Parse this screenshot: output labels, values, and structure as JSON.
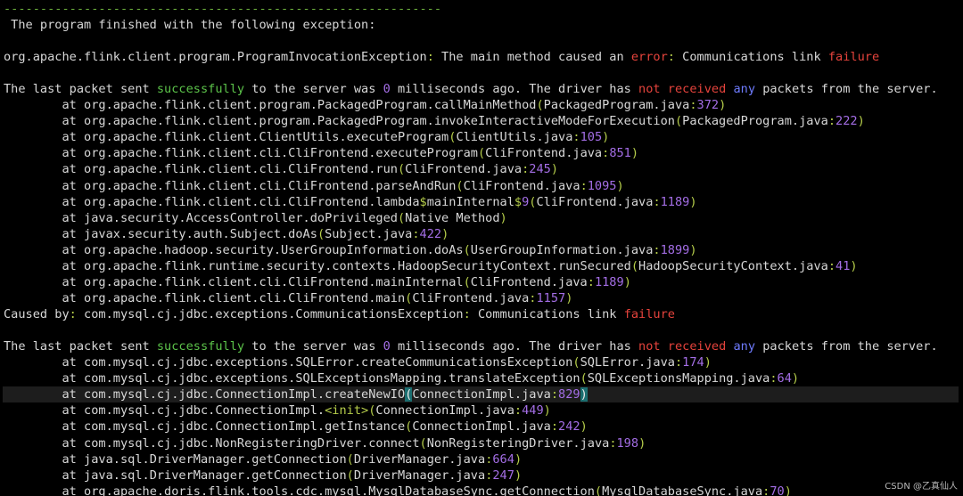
{
  "colors": {
    "background": "#000000",
    "text": "#d8d8d8",
    "separator": "#68a93b",
    "punctuation": "#b5cd4a",
    "number": "#a46ee6",
    "keyword_red": "#e5433c",
    "keyword_green": "#5cc34a",
    "keyword_blue": "#6f7cff",
    "cursor_highlight": "#1b6e70"
  },
  "terminal": {
    "separator": "------------------------------------------------------------",
    "header": " The program finished with the following exception:",
    "exception_line": {
      "class": "org.apache.flink.client.program.ProgramInvocationException",
      "colon": ":",
      "message1": " The main method caused an ",
      "word_error": "error",
      "colon2": ":",
      "message2": " Communications link ",
      "word_failure": "failure"
    },
    "packet_line": {
      "p1": "The last packet sent ",
      "w_successfully": "successfully",
      "p2": " to the server was ",
      "n_ms": "0",
      "p3": " milliseconds ago. The driver has ",
      "w_not": "not",
      "sp1": " ",
      "w_received": "received",
      "sp2": " ",
      "w_any": "any",
      "p4": " packets from the server."
    },
    "stack1": [
      {
        "prefix": "        at ",
        "method": "org.apache.flink.client.program.PackagedProgram.callMainMethod",
        "open": "(",
        "file": "PackagedProgram.java",
        "colon": ":",
        "line": "372",
        "close": ")"
      },
      {
        "prefix": "        at ",
        "method": "org.apache.flink.client.program.PackagedProgram.invokeInteractiveModeForExecution",
        "open": "(",
        "file": "PackagedProgram.java",
        "colon": ":",
        "line": "222",
        "close": ")"
      },
      {
        "prefix": "        at ",
        "method": "org.apache.flink.client.ClientUtils.executeProgram",
        "open": "(",
        "file": "ClientUtils.java",
        "colon": ":",
        "line": "105",
        "close": ")"
      },
      {
        "prefix": "        at ",
        "method": "org.apache.flink.client.cli.CliFrontend.executeProgram",
        "open": "(",
        "file": "CliFrontend.java",
        "colon": ":",
        "line": "851",
        "close": ")"
      },
      {
        "prefix": "        at ",
        "method": "org.apache.flink.client.cli.CliFrontend.run",
        "open": "(",
        "file": "CliFrontend.java",
        "colon": ":",
        "line": "245",
        "close": ")"
      },
      {
        "prefix": "        at ",
        "method": "org.apache.flink.client.cli.CliFrontend.parseAndRun",
        "open": "(",
        "file": "CliFrontend.java",
        "colon": ":",
        "line": "1095",
        "close": ")"
      },
      {
        "prefix": "        at ",
        "method": "org.apache.flink.client.cli.CliFrontend.lambda",
        "dollar": "$",
        "method2": "mainInternal",
        "dollar2": "$",
        "lambda_num": "9",
        "open": "(",
        "file": "CliFrontend.java",
        "colon": ":",
        "line": "1189",
        "close": ")"
      },
      {
        "prefix": "        at ",
        "method": "java.security.AccessController.doPrivileged",
        "open": "(",
        "file": "Native Method",
        "colon": "",
        "line": "",
        "close": ")"
      },
      {
        "prefix": "        at ",
        "method": "javax.security.auth.Subject.doAs",
        "open": "(",
        "file": "Subject.java",
        "colon": ":",
        "line": "422",
        "close": ")"
      },
      {
        "prefix": "        at ",
        "method": "org.apache.hadoop.security.UserGroupInformation.doAs",
        "open": "(",
        "file": "UserGroupInformation.java",
        "colon": ":",
        "line": "1899",
        "close": ")"
      },
      {
        "prefix": "        at ",
        "method": "org.apache.flink.runtime.security.contexts.HadoopSecurityContext.runSecured",
        "open": "(",
        "file": "HadoopSecurityContext.java",
        "colon": ":",
        "line": "41",
        "close": ")"
      },
      {
        "prefix": "        at ",
        "method": "org.apache.flink.client.cli.CliFrontend.mainInternal",
        "open": "(",
        "file": "CliFrontend.java",
        "colon": ":",
        "line": "1189",
        "close": ")"
      },
      {
        "prefix": "        at ",
        "method": "org.apache.flink.client.cli.CliFrontend.main",
        "open": "(",
        "file": "CliFrontend.java",
        "colon": ":",
        "line": "1157",
        "close": ")"
      }
    ],
    "caused_by": {
      "label": "Caused by",
      "colon": ":",
      "class": " com.mysql.cj.jdbc.exceptions.CommunicationsException",
      "colon2": ":",
      "message": " Communications link ",
      "word_failure": "failure"
    },
    "stack2": [
      {
        "prefix": "        at ",
        "method": "com.mysql.cj.jdbc.exceptions.SQLError.createCommunicationsException",
        "open": "(",
        "file": "SQLError.java",
        "colon": ":",
        "line": "174",
        "close": ")"
      },
      {
        "prefix": "        at ",
        "method": "com.mysql.cj.jdbc.exceptions.SQLExceptionsMapping.translateException",
        "open": "(",
        "file": "SQLExceptionsMapping.java",
        "colon": ":",
        "line": "64",
        "close": ")"
      },
      {
        "prefix": "        at ",
        "method": "com.mysql.cj.jdbc.ConnectionImpl.createNewIO",
        "open": "(",
        "file": "ConnectionImpl.java",
        "colon": ":",
        "line": "829",
        "close": ")",
        "highlight": true
      },
      {
        "prefix": "        at ",
        "method": "com.mysql.cj.jdbc.ConnectionImpl.",
        "tag": "<init>",
        "open": "(",
        "file": "ConnectionImpl.java",
        "colon": ":",
        "line": "449",
        "close": ")"
      },
      {
        "prefix": "        at ",
        "method": "com.mysql.cj.jdbc.ConnectionImpl.getInstance",
        "open": "(",
        "file": "ConnectionImpl.java",
        "colon": ":",
        "line": "242",
        "close": ")"
      },
      {
        "prefix": "        at ",
        "method": "com.mysql.cj.jdbc.NonRegisteringDriver.connect",
        "open": "(",
        "file": "NonRegisteringDriver.java",
        "colon": ":",
        "line": "198",
        "close": ")"
      },
      {
        "prefix": "        at ",
        "method": "java.sql.DriverManager.getConnection",
        "open": "(",
        "file": "DriverManager.java",
        "colon": ":",
        "line": "664",
        "close": ")"
      },
      {
        "prefix": "        at ",
        "method": "java.sql.DriverManager.getConnection",
        "open": "(",
        "file": "DriverManager.java",
        "colon": ":",
        "line": "247",
        "close": ")"
      },
      {
        "prefix": "        at ",
        "method": "org.apache.doris.flink.tools.cdc.mysql.MysqlDatabaseSync.getConnection",
        "open": "(",
        "file": "MysqlDatabaseSync.java",
        "colon": ":",
        "line": "70",
        "close": ")"
      }
    ],
    "watermark": "CSDN @乙真仙人"
  }
}
